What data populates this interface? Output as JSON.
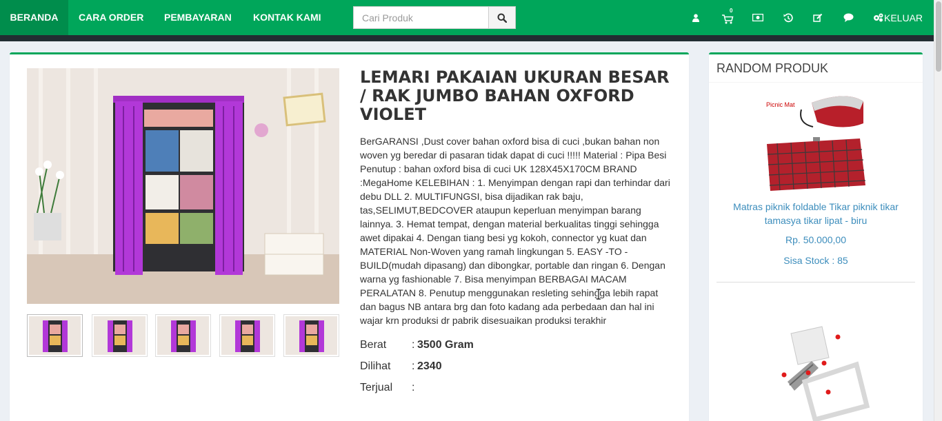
{
  "nav": {
    "items": [
      {
        "label": "BERANDA",
        "active": true
      },
      {
        "label": "CARA ORDER",
        "active": false
      },
      {
        "label": "PEMBAYARAN",
        "active": false
      },
      {
        "label": "KONTAK KAMI",
        "active": false
      }
    ],
    "search": {
      "placeholder": "Cari Produk",
      "value": ""
    },
    "cart_count": "0",
    "icons": [
      "user-icon",
      "shopping-cart-icon",
      "money-icon",
      "history-icon",
      "edit-icon",
      "comment-icon",
      "cogs-icon"
    ],
    "logout_label": "KELUAR",
    "brand_color": "#00a65a",
    "dark_strip_color": "#222d32"
  },
  "product": {
    "title": "LEMARI PAKAIAN UKURAN BESAR / RAK JUMBO BAHAN OXFORD VIOLET",
    "description": "BerGARANSI ,Dust cover bahan oxford bisa di cuci ,bukan bahan non woven yg beredar di pasaran tidak dapat di cuci !!!!! Material : Pipa Besi Penutup : bahan oxford bisa di cuci UK 128X45X170CM BRAND :MegaHome KELEBIHAN : 1. Menyimpan dengan rapi dan terhindar dari debu DLL 2. MULTIFUNGSI, bisa dijadikan rak baju, tas,SELIMUT,BEDCOVER ataupun keperluan menyimpan barang lainnya. 3. Hemat tempat, dengan material berkualitas tinggi sehingga awet dipakai 4. Dengan tiang besi yg kokoh, connector yg kuat dan MATERIAL Non-Woven yang ramah lingkungan 5. EASY -TO -BUILD(mudah dipasang) dan dibongkar, portable dan ringan 6. Dengan warna yg fashionable 7. Bisa menyimpan BERBAGAI MACAM PERALATAN 8. Penutup menggunakan resleting sehingga lebih rapat dan bagus NB antara brg dan foto kadang ada perbedaan dan hal ini wajar krn produksi dr pabrik disesuaikan produksi terakhir",
    "specs": [
      {
        "label": "Berat",
        "value": "3500 Gram"
      },
      {
        "label": "Dilihat",
        "value": "2340"
      },
      {
        "label": "Terjual",
        "value": ""
      }
    ],
    "thumbnail_count": 5
  },
  "sidebar": {
    "title": "RANDOM PRODUK",
    "products": [
      {
        "name": "Matras piknik foldable Tikar piknik tikar tamasya tikar lipat - biru",
        "price": "Rp. 50.000,00",
        "stock": "Sisa Stock : 85",
        "image_label": "Picnic Mat"
      },
      {
        "name": "",
        "price": "",
        "stock": "",
        "image_label": ""
      }
    ]
  }
}
